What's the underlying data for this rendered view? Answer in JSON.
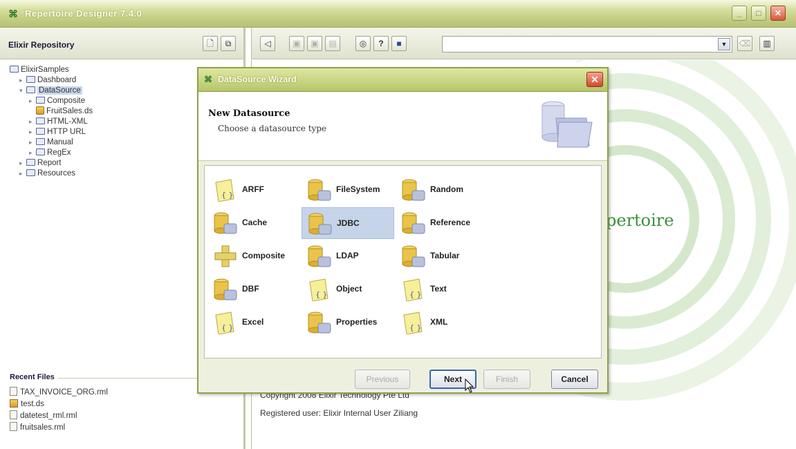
{
  "window": {
    "title": "Repertoire Designer 7.4.0"
  },
  "left_panel": {
    "header": "Elixir Repository",
    "tree": [
      {
        "label": "ElixirSamples",
        "level": 0,
        "type": "folder"
      },
      {
        "label": "Dashboard",
        "level": 1,
        "type": "folder"
      },
      {
        "label": "DataSource",
        "level": 1,
        "type": "folder",
        "selected": true
      },
      {
        "label": "Composite",
        "level": 2,
        "type": "folder"
      },
      {
        "label": "FruitSales.ds",
        "level": 2,
        "type": "file"
      },
      {
        "label": "HTML-XML",
        "level": 2,
        "type": "folder"
      },
      {
        "label": "HTTP URL",
        "level": 2,
        "type": "folder"
      },
      {
        "label": "Manual",
        "level": 2,
        "type": "folder"
      },
      {
        "label": "RegEx",
        "level": 2,
        "type": "folder"
      },
      {
        "label": "Report",
        "level": 1,
        "type": "folder"
      },
      {
        "label": "Resources",
        "level": 1,
        "type": "folder"
      }
    ],
    "recent_files": {
      "header": "Recent Files",
      "items": [
        "TAX_INVOICE_ORG.rml",
        "test.ds",
        "datetest_rml.rml",
        "fruitsales.rml"
      ]
    }
  },
  "main": {
    "logo_text": "pertoire",
    "copyright": "Copyright 2008 Elixir Technology Pte Ltd",
    "registered": "Registered user: Elixir Internal User Ziliang"
  },
  "dialog": {
    "title": "DataSource Wizard",
    "heading": "New Datasource",
    "subheading": "Choose a datasource type",
    "datasources": [
      {
        "label": "ARFF",
        "icon": "arff-icon"
      },
      {
        "label": "FileSystem",
        "icon": "filesystem-icon"
      },
      {
        "label": "Random",
        "icon": "random-icon"
      },
      {
        "label": "Cache",
        "icon": "cache-icon"
      },
      {
        "label": "JDBC",
        "icon": "jdbc-icon",
        "selected": true
      },
      {
        "label": "Reference",
        "icon": "reference-icon"
      },
      {
        "label": "Composite",
        "icon": "composite-icon"
      },
      {
        "label": "LDAP",
        "icon": "ldap-icon"
      },
      {
        "label": "Tabular",
        "icon": "tabular-icon"
      },
      {
        "label": "DBF",
        "icon": "dbf-icon"
      },
      {
        "label": "Object",
        "icon": "object-icon"
      },
      {
        "label": "Text",
        "icon": "text-icon"
      },
      {
        "label": "Excel",
        "icon": "excel-icon"
      },
      {
        "label": "Properties",
        "icon": "properties-icon"
      },
      {
        "label": "XML",
        "icon": "xml-icon"
      }
    ],
    "buttons": {
      "previous": "Previous",
      "next": "Next",
      "finish": "Finish",
      "cancel": "Cancel"
    }
  },
  "colors": {
    "title_bar": "#c6cf86",
    "selection": "#c6d4ea",
    "logo_green": "#3e8e3e",
    "close_red": "#d14a2e"
  }
}
